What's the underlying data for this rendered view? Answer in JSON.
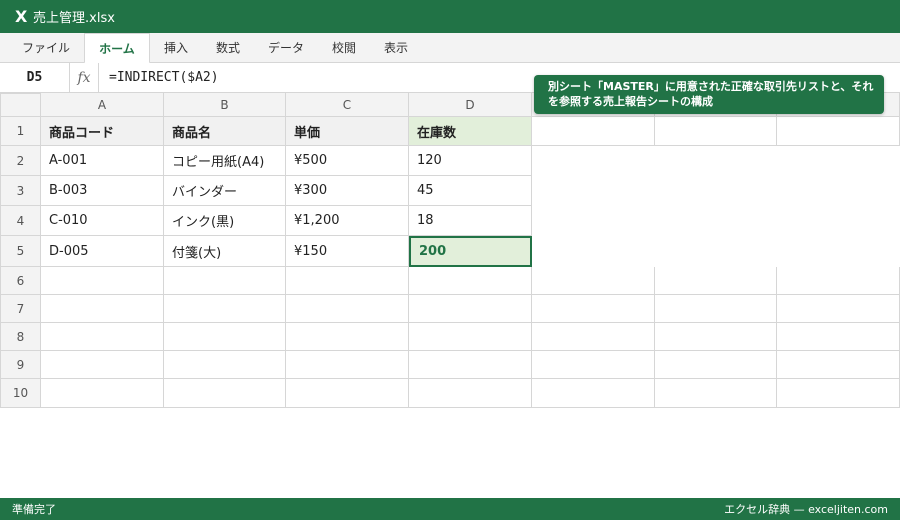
{
  "app": {
    "icon": "excel-x-icon",
    "icon_glyph": "X",
    "title": "売上管理.xlsx",
    "accent": "#217346",
    "accent_light": "#e2efda"
  },
  "ribbon": {
    "tabs": [
      "ファイル",
      "ホーム",
      "挿入",
      "数式",
      "データ",
      "校閲",
      "表示"
    ],
    "active_tab": "ホーム"
  },
  "formula_bar": {
    "name_box": "D5",
    "fx_label": "fx",
    "formula": "=INDIRECT($A2)"
  },
  "callout": {
    "text": "別シート「MASTER」に用意された正確な取引先リストと、それを参照する売上報告シートの構成"
  },
  "sheet": {
    "columns": [
      "A",
      "B",
      "C",
      "D"
    ],
    "rows": [
      "1",
      "2",
      "3",
      "4",
      "5",
      "6",
      "7",
      "8",
      "9",
      "10"
    ],
    "header": [
      "商品コード",
      "商品名",
      "単価",
      "在庫数"
    ],
    "data": [
      [
        "A-001",
        "コピー用紙(A4)",
        "¥500",
        "120"
      ],
      [
        "B-003",
        "バインダー",
        "¥300",
        "45"
      ],
      [
        "C-010",
        "インク(黒)",
        "¥1,200",
        "18"
      ],
      [
        "D-005",
        "付箋(大)",
        "¥150",
        "200"
      ]
    ],
    "selected_cell": "D5"
  },
  "status": {
    "left": "準備完了",
    "right": "エクセル辞典 — exceljiten.com"
  }
}
